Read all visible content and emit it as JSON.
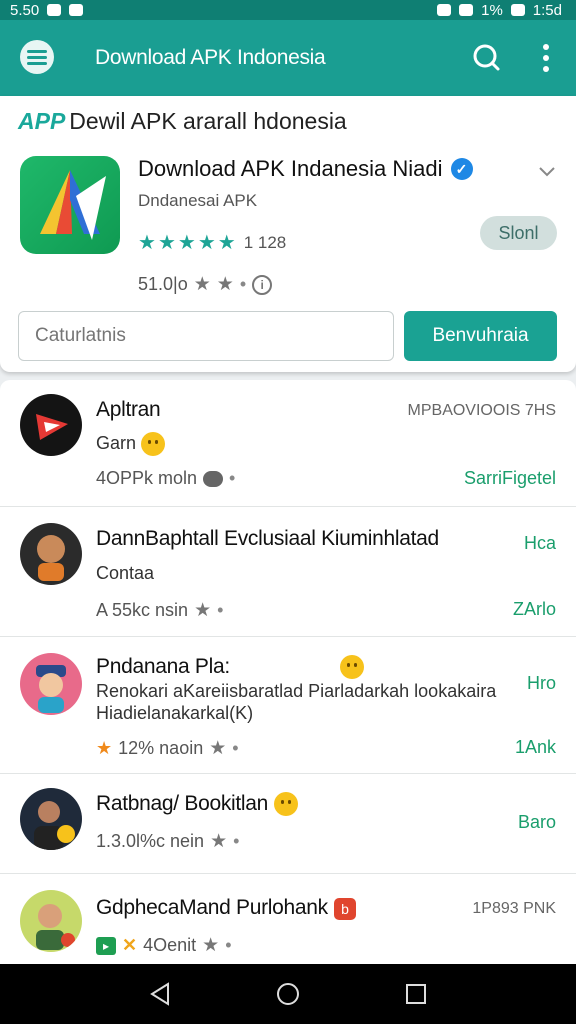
{
  "status_bar": {
    "time": "5.50",
    "right_text": "1%",
    "clock": "1:5d"
  },
  "toolbar": {
    "title": "Download APK Indonesia"
  },
  "header": {
    "section_tag": "APP",
    "section_title": "Dewil APK ararall hdonesia",
    "app_name": "Download APK Indanesia Niadi",
    "developer": "Dndanesai APK",
    "rating_count": "1 128",
    "start_label": "Slonl",
    "meta_text": "51.0|o",
    "search_placeholder": "Caturlatnis",
    "download_label": "Benvuhraia"
  },
  "list": [
    {
      "title": "Apltran",
      "sub": "Garn",
      "meta": "4OPPk moln",
      "action": "SarriFigetel",
      "top_right": "MPBAOVIOOIS 7HS"
    },
    {
      "title": "DannBaphtall Evclusiaal Kiuminhlatad",
      "sub": "Contaa",
      "meta": "A 55kc nsin",
      "action": "ZArlo",
      "top_right": "Hca"
    },
    {
      "title": "Pndanana Pla:",
      "sub": "Renokari aKareiisbaratlad Piarladarkah lookakaira",
      "sub2": "Hiadielanakarkal(K)",
      "meta": "12% naoin",
      "action": "1Ank",
      "top_right": "Hro"
    },
    {
      "title": "Ratbnag/ Bookitlan",
      "meta": "1.3.0l%c nein",
      "action": "Baro"
    },
    {
      "title": "GdphecaMand Purlohank",
      "meta": "4Oenit",
      "top_right": "1P893 PNK"
    }
  ],
  "colors": {
    "primary": "#1a9e92",
    "status": "#0f7f73",
    "accent_green": "#1a9e6c"
  }
}
